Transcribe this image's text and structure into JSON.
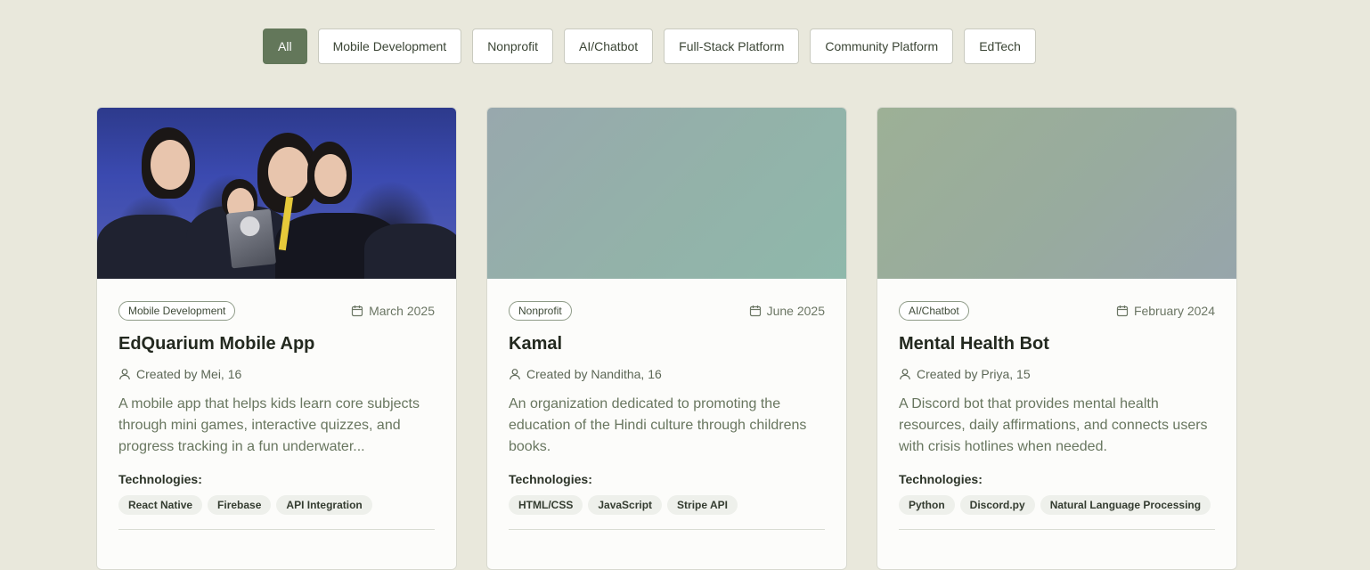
{
  "filters": [
    {
      "label": "All",
      "active": true
    },
    {
      "label": "Mobile Development",
      "active": false
    },
    {
      "label": "Nonprofit",
      "active": false
    },
    {
      "label": "AI/Chatbot",
      "active": false
    },
    {
      "label": "Full-Stack Platform",
      "active": false
    },
    {
      "label": "Community Platform",
      "active": false
    },
    {
      "label": "EdTech",
      "active": false
    }
  ],
  "projects": [
    {
      "image": "team-award-photo",
      "category": "Mobile Development",
      "date": "March 2025",
      "title": "EdQuarium Mobile App",
      "author": "Created by Mei, 16",
      "description": "A mobile app that helps kids learn core subjects through mini games, interactive quizzes, and progress tracking in a fun underwater...",
      "technologies_label": "Technologies:",
      "technologies": [
        "React Native",
        "Firebase",
        "API Integration"
      ]
    },
    {
      "image": "gradient-placeholder-teal",
      "category": "Nonprofit",
      "date": "June 2025",
      "title": "Kamal",
      "author": "Created by Nanditha, 16",
      "description": "An organization dedicated to promoting the education of the Hindi culture through childrens books.",
      "technologies_label": "Technologies:",
      "technologies": [
        "HTML/CSS",
        "JavaScript",
        "Stripe API"
      ]
    },
    {
      "image": "gradient-placeholder-green",
      "category": "AI/Chatbot",
      "date": "February 2024",
      "title": "Mental Health Bot",
      "author": "Created by Priya, 15",
      "description": "A Discord bot that provides mental health resources, daily affirmations, and connects users with crisis hotlines when needed.",
      "technologies_label": "Technologies:",
      "technologies": [
        "Python",
        "Discord.py",
        "Natural Language Processing"
      ]
    }
  ],
  "icons": {
    "date": "calendar-icon",
    "author": "user-icon"
  },
  "colors": {
    "accent": "#63775a",
    "background": "#e9e8dc"
  }
}
